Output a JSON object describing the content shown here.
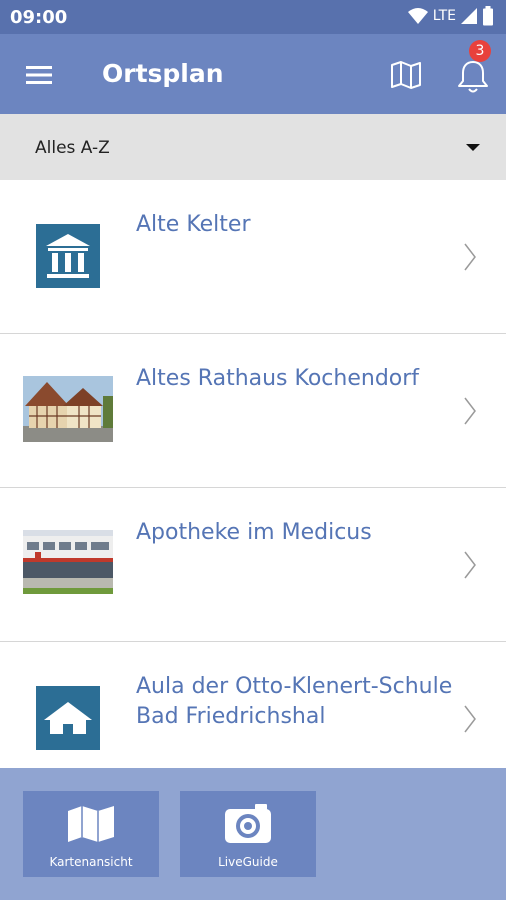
{
  "status_bar": {
    "time": "09:00",
    "network": "LTE",
    "icons": [
      "wifi-icon",
      "signal-icon",
      "battery-icon"
    ]
  },
  "app_bar": {
    "title": "Ortsplan",
    "menu_icon": "hamburger-menu-icon",
    "map_icon": "map-icon",
    "notification_icon": "bell-icon",
    "notification_count": "3",
    "background": "#6c85c0"
  },
  "filter": {
    "selected": "Alles A-Z",
    "icon": "caret-down-icon"
  },
  "places": [
    {
      "name": "Alte Kelter",
      "thumbnail": "museum-icon"
    },
    {
      "name": "Altes Rathaus Kochendorf",
      "thumbnail": "photo-half-timbered-town-hall"
    },
    {
      "name": "Apotheke im Medicus",
      "thumbnail": "photo-pharmacy-building"
    },
    {
      "name": "Aula der Otto-Klenert-Schule Bad Friedrichshal",
      "thumbnail": "house-icon"
    }
  ],
  "bottom_bar": {
    "buttons": [
      {
        "label": "Kartenansicht",
        "icon": "map-icon"
      },
      {
        "label": "LiveGuide",
        "icon": "camera-icon"
      }
    ]
  },
  "colors": {
    "status_bar": "#5871ad",
    "app_bar": "#6c85c0",
    "bottom_bar": "#90a4d1",
    "link_text": "#5575b5",
    "icon_tile": "#2c6e95",
    "badge": "#e8413c"
  }
}
